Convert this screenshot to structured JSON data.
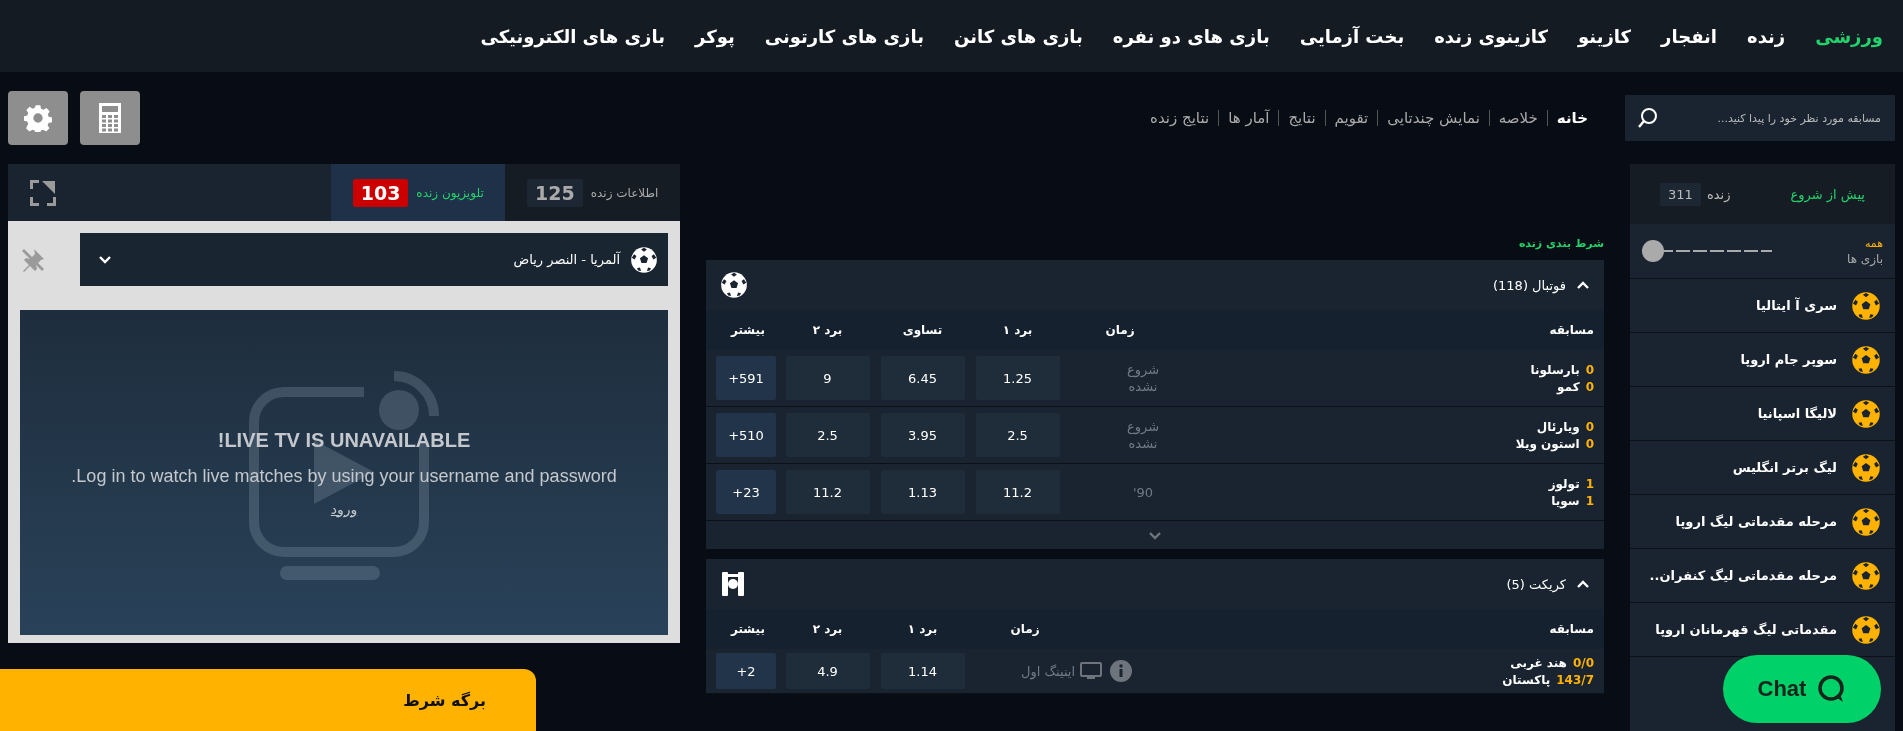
{
  "nav": [
    {
      "label": "ورزشی",
      "selected": true
    },
    {
      "label": "زنده",
      "selected": false
    },
    {
      "label": "انفجار",
      "selected": false
    },
    {
      "label": "کازینو",
      "selected": false
    },
    {
      "label": "کازینوی زنده",
      "selected": false
    },
    {
      "label": "بخت آزمایی",
      "selected": false
    },
    {
      "label": "بازی های دو نفره",
      "selected": false
    },
    {
      "label": "بازی های کانن",
      "selected": false
    },
    {
      "label": "بازی های کارتونی",
      "selected": false
    },
    {
      "label": "پوکر",
      "selected": false
    },
    {
      "label": "بازی های الکترونیکی",
      "selected": false
    }
  ],
  "search": {
    "placeholder": "مسابقه مورد نظر خود را پیدا کنید..."
  },
  "subnav": [
    {
      "label": "خانه",
      "selected": true
    },
    {
      "label": "خلاصه",
      "selected": false
    },
    {
      "label": "نمایش چندتایی",
      "selected": false
    },
    {
      "label": "تقویم",
      "selected": false
    },
    {
      "label": "نتایج",
      "selected": false
    },
    {
      "label": "آمار ها",
      "selected": false
    },
    {
      "label": "نتایج زنده",
      "selected": false
    }
  ],
  "sidebar": {
    "tabs": [
      {
        "label": "پیش از شروع",
        "selected": true
      },
      {
        "label": "زنده",
        "count": "311",
        "selected": false
      }
    ],
    "filter": {
      "label": "همه",
      "sublabel": "بازی ها",
      "level": 0
    },
    "items": [
      {
        "label": "سری آ ایتالیا"
      },
      {
        "label": "سوپر جام اروپا"
      },
      {
        "label": "لالیگا اسپانیا"
      },
      {
        "label": "لیگ برتر انگلیس"
      },
      {
        "label": "مرحله مقدماتی لیگ اروپا"
      },
      {
        "label": "مرحله مقدماتی لیگ کنفران.."
      },
      {
        "label": "مقدماتی لیگ قهرمانان اروپا"
      }
    ]
  },
  "live_betting": {
    "title": "شرط بندی زنده",
    "sections": [
      {
        "kind": "football",
        "title": "فوتبال",
        "count": "(118)",
        "expanded": true,
        "show_more": true,
        "columns": [
          "مسابقه",
          "زمان",
          "برد ۱",
          "تساوی",
          "برد ۲",
          "بیشتر"
        ],
        "rows": [
          {
            "team1": "بارسلونا",
            "score1": "0",
            "team2": "کمو",
            "score2": "0",
            "time": "شروع نشده",
            "tv": false,
            "info": false,
            "odds": [
              "1.25",
              "6.45",
              "9"
            ],
            "more": "+591"
          },
          {
            "team1": "ویارئال",
            "score1": "0",
            "team2": "استون ویلا",
            "score2": "0",
            "time": "شروع نشده",
            "tv": false,
            "info": false,
            "odds": [
              "2.5",
              "3.95",
              "2.5"
            ],
            "more": "+510"
          },
          {
            "team1": "تولوز",
            "score1": "1",
            "team2": "سویا",
            "score2": "1",
            "time": "90'",
            "tv": false,
            "info": false,
            "odds": [
              "11.2",
              "1.13",
              "11.2"
            ],
            "more": "+23"
          }
        ]
      },
      {
        "kind": "cricket",
        "title": "کریکت",
        "count": "(5)",
        "expanded": true,
        "show_more": false,
        "columns": [
          "مسابقه",
          "زمان",
          "برد ۱",
          "برد ۲",
          "بیشتر"
        ],
        "rows": [
          {
            "team1": "هند غربی",
            "score1": "0/0",
            "team2": "پاکستان",
            "score2": "143/7",
            "time": "اینینگ اول",
            "tv": true,
            "info": true,
            "odds": [
              "1.14",
              "4.9"
            ],
            "more": "+2"
          }
        ]
      }
    ]
  },
  "live_panel": {
    "tabs": [
      {
        "label": "اطلاعات زنده",
        "count": "125",
        "selected": false
      },
      {
        "label": "تلویزیون زنده",
        "count": "103",
        "selected": true
      }
    ],
    "match": "آلمریا - النصر ریاض",
    "tv": {
      "title": "LIVE TV IS UNAVAILABLE!",
      "message": "Log in to watch live matches by using your username and password.",
      "login": "ورود"
    }
  },
  "betslip": {
    "title": "برگه شرط"
  },
  "chat": {
    "label": "Chat"
  }
}
